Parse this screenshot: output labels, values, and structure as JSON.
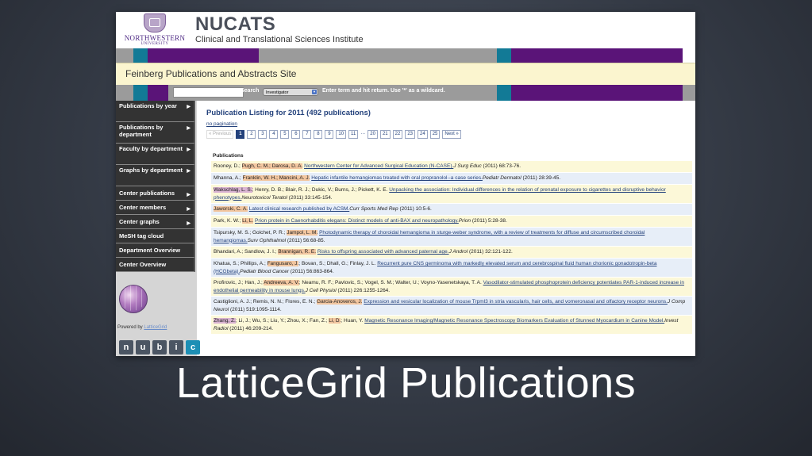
{
  "header": {
    "university": "NORTHWESTERN",
    "university_sub": "UNIVERSITY",
    "brand_title": "NUCATS",
    "brand_subtitle": "Clinical and Translational Sciences Institute"
  },
  "site_title": "Feinberg Publications and Abstracts Site",
  "search": {
    "label": "Search",
    "selected": "Investigator",
    "hint": "Enter term and hit return. Use '*' as a wildcard."
  },
  "sidebar": {
    "items": [
      {
        "label": "Publications by year"
      },
      {
        "label": "Publications by department"
      },
      {
        "label": "Faculty by department"
      },
      {
        "label": "Graphs by department"
      },
      {
        "label": "Center publications"
      },
      {
        "label": "Center members"
      },
      {
        "label": "Center graphs"
      },
      {
        "label": "MeSH tag cloud"
      },
      {
        "label": "Department Overview"
      },
      {
        "label": "Center Overview"
      }
    ],
    "powered_by": "Powered by",
    "powered_link": "LatticeGrid",
    "nubic": [
      "n",
      "u",
      "b",
      "i",
      "c"
    ]
  },
  "main": {
    "title": "Publication Listing for 2011 (492 publications)",
    "no_pagination": "no pagination",
    "pager": {
      "prev": "« Previous",
      "pages": [
        "1",
        "2",
        "3",
        "4",
        "5",
        "6",
        "7",
        "8",
        "9",
        "10",
        "11"
      ],
      "dots": "…",
      "tail_pages": [
        "20",
        "21",
        "22",
        "23",
        "24",
        "25"
      ],
      "next": "Next »"
    },
    "publications_heading": "Publications",
    "pubs": [
      {
        "authors": "Rooney, D.; ",
        "hl": "Pugh, C. M.; Darosa, D. A.",
        "title": "Northwestern Center for Advanced Surgical Education (N-CASE).",
        "journal": "J Surg Educ",
        "rest": " (2011) 68:73-76."
      },
      {
        "authors": "Mhanna, A.; ",
        "hl": "Franklin, W. H.; Mancini, A. J.",
        "title": "Hepatic infantile hemangiomas treated with oral propranolol--a case series.",
        "journal": "Pediatr Dermatol",
        "rest": " (2011) 28:39-45."
      },
      {
        "authors": "",
        "hl": "Wakschlag, L. S.",
        "after": "; Henry, D. B.; Blair, R. J.; Dukic, V.; Burns, J.; Pickett, K. E. ",
        "title": "Unpacking the association: Individual differences in the relation of prenatal exposure to cigarettes and disruptive behavior phenotypes.",
        "journal": "Neurotoxicol Teratol",
        "rest": " (2011) 33:145-154."
      },
      {
        "authors": "",
        "hl": "Jaworski, C. A.",
        "title": "Latest clinical research published by ACSM.",
        "journal": "Curr Sports Med Rep",
        "rest": " (2011) 10:5-6."
      },
      {
        "authors": "Park, K. W.; ",
        "hl": "Li, L.",
        "title": "Prion protein in Caenorhabditis elegans: Distinct models of anti-BAX and neuropathology.",
        "journal": "Prion",
        "rest": " (2011) 5:28-38."
      },
      {
        "authors": "Tsipursky, M. S.; Golchet, P. R.; ",
        "hl": "Jampol, L. M.",
        "title": "Photodynamic therapy of choroidal hemangioma in sturge-weber syndrome, with a review of treatments for diffuse and circumscribed choroidal hemangiomas.",
        "journal": "Surv Ophthalmol",
        "rest": " (2011) 56:68-85."
      },
      {
        "authors": "Bhandari, A.; Sandlow, J. I.; ",
        "hl": "Brannigan, R. E.",
        "title": "Risks to offspring associated with advanced paternal age.",
        "journal": "J Androl",
        "rest": " (2011) 32:121-122."
      },
      {
        "authors": "Khatua, S.; Phillips, A.; ",
        "hl": "Fangusaro, J.",
        "after": "; Bovan, S.; Dhall, G.; Finlay, J. L. ",
        "title": "Recurrent pure CNS germinoma with markedly elevated serum and cerebrospinal fluid human chorionic gonadotropin-beta (HCGbeta).",
        "journal": "Pediatr Blood Cancer",
        "rest": " (2011) 56:863-864."
      },
      {
        "authors": "Profirovic, J.; Han, J.; ",
        "hl": "Andreeva, A. V.",
        "after": "; Neamu, R. F.; Pavlovic, S.; Vogel, S. M.; Walter, U.; Voyno-Yasenetskaya, T. A. ",
        "title": "Vasodilator-stimulated phosphoprotein deficiency potentiates PAR-1-induced increase in endothelial permeability in mouse lungs.",
        "journal": "J Cell Physiol",
        "rest": " (2011) 226:1255-1264."
      },
      {
        "authors": "Castiglioni, A. J.; Remis, N. N.; Flores, E. N.; ",
        "hl": "Garcia-Anoveros, J.",
        "title": "Expression and vesicular localization of mouse Trpml3 in stria vascularis, hair cells, and vomeronasal and olfactory receptor neurons.",
        "journal": "J Comp Neurol",
        "rest": " (2011) 519:1095-1114."
      },
      {
        "authors": "",
        "hl": "Zhang, Z.",
        "after": "; Li, J.; Wu, S.; Liu, Y.; Zhou, X.; Fan, Z.; ",
        "hl2": "Li, D.",
        "after2": "; Huan, Y. ",
        "title": "Magnetic Resonance Imaging/Magnetic Resonance Spectroscopy Biomarkers Evaluation of Stunned Myocardium in Canine Model.",
        "journal": "Invest Radiol",
        "rest": " (2011) 46:209-214."
      }
    ]
  },
  "caption": "LatticeGrid Publications",
  "colors": {
    "teal": "#127a96",
    "purple": "#5a1478",
    "title_blue": "#24427c",
    "highlight": "#f2c6a0"
  }
}
